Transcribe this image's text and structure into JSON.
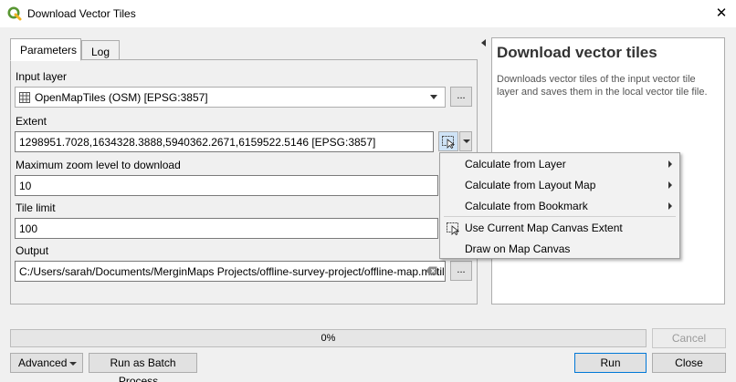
{
  "window": {
    "title": "Download Vector Tiles",
    "close_glyph": "✕"
  },
  "tabs": [
    {
      "label": "Parameters",
      "active": true
    },
    {
      "label": "Log",
      "active": false
    }
  ],
  "form": {
    "input_layer": {
      "label": "Input layer",
      "value": "OpenMapTiles (OSM) [EPSG:3857]",
      "browse_label": "..."
    },
    "extent": {
      "label": "Extent",
      "value": "1298951.7028,1634328.3888,5940362.2671,6159522.5146 [EPSG:3857]"
    },
    "max_zoom": {
      "label": "Maximum zoom level to download",
      "value": "10"
    },
    "tile_limit": {
      "label": "Tile limit",
      "value": "100"
    },
    "output": {
      "label": "Output",
      "value": "C:/Users/sarah/Documents/MerginMaps Projects/offline-survey-project/offline-map.mbtiles",
      "browse_label": "..."
    }
  },
  "help": {
    "title": "Download vector tiles",
    "body": "Downloads vector tiles of the input vector tile layer and saves them in the local vector tile file."
  },
  "context_menu": {
    "items": [
      {
        "label": "Calculate from Layer",
        "submenu": true
      },
      {
        "label": "Calculate from Layout Map",
        "submenu": true
      },
      {
        "label": "Calculate from Bookmark",
        "submenu": true
      },
      {
        "label": "Use Current Map Canvas Extent",
        "submenu": false,
        "icon": "map-canvas-extent-icon"
      },
      {
        "label": "Draw on Map Canvas",
        "submenu": false
      }
    ]
  },
  "progress": {
    "text": "0%",
    "value": 0
  },
  "buttons": {
    "cancel": "Cancel",
    "advanced": "Advanced",
    "batch": "Run as Batch Process...",
    "run": "Run",
    "close": "Close"
  },
  "colors": {
    "accent": "#0078d7",
    "qgis_green": "#589632"
  }
}
